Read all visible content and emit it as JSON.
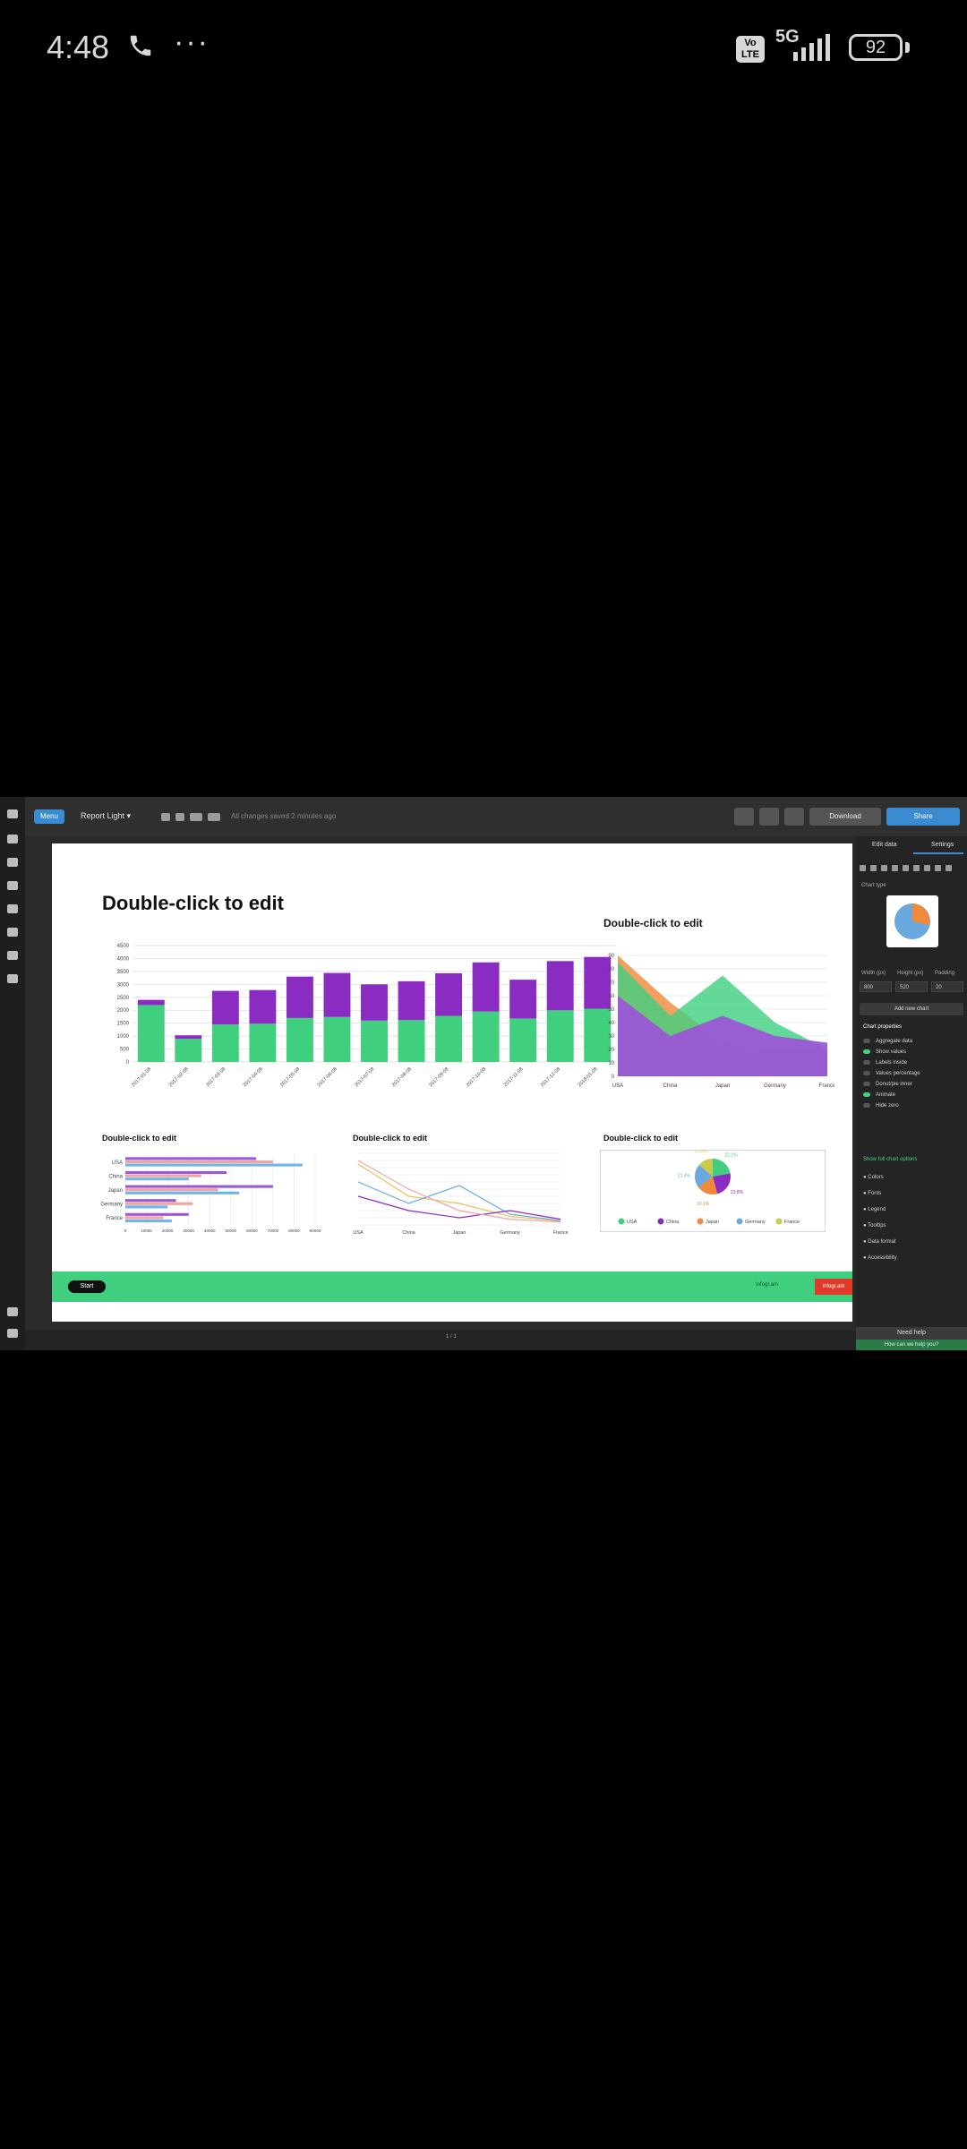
{
  "status_bar": {
    "time": "4:48",
    "call_icon": "phone-icon",
    "more": "···",
    "volte": "Vo LTE",
    "network": "5G",
    "battery": "92"
  },
  "app": {
    "menu_button": "Menu",
    "theme_select": "Report Light",
    "toolbar_hint": "All changes saved 2 minutes ago",
    "download_label": "Download",
    "share_label": "Share"
  },
  "canvas": {
    "main_title": "Double-click to edit",
    "area_title": "Double-click to edit",
    "hbar_title": "Double-click to edit",
    "line_title": "Double-click to edit",
    "pie_title": "Double-click to edit",
    "footer_pill": "Start",
    "footer_text": "Infogr.am",
    "footer_ribbon": "infogr.am",
    "caption": "1 / 1"
  },
  "sidebar": {
    "tab_edit": "Edit data",
    "tab_settings": "Settings",
    "chart_type_label": "Chart type",
    "width_label": "Width (px)",
    "height_label": "Height (px)",
    "padding_label": "Padding",
    "width_value": "800",
    "height_value": "520",
    "padding_value": "20",
    "convert_button": "Add new chart",
    "props_header": "Chart properties",
    "rows": [
      "Aggregate data",
      "Show values",
      "Labels inside",
      "Values percentage",
      "Donut/pie inner",
      "Animate",
      "Hide zero"
    ],
    "link": "Show full chart options",
    "sections": [
      "Colors",
      "Fonts",
      "Legend",
      "Tooltips",
      "Data format",
      "Accessibility"
    ],
    "help_button": "Need help",
    "bottom_text": "How can we help you?"
  },
  "chart_data": [
    {
      "type": "bar",
      "title": "Double-click to edit",
      "categories": [
        "2017-01-08",
        "2017-02-08",
        "2017-03-08",
        "2017-04-08",
        "2017-05-08",
        "2017-06-08",
        "2017-07-08",
        "2017-08-08",
        "2017-09-08",
        "2017-10-08",
        "2017-11-08",
        "2017-12-08",
        "2018-01-08"
      ],
      "series": [
        {
          "values": [
            2200,
            900,
            1450,
            1480,
            1700,
            1740,
            1600,
            1620,
            1780,
            1950,
            1680,
            2000,
            2060
          ]
        },
        {
          "values": [
            200,
            130,
            1300,
            1300,
            1600,
            1700,
            1400,
            1500,
            1650,
            1900,
            1500,
            1900,
            2000
          ]
        }
      ],
      "ylim": [
        0,
        4500
      ],
      "yticks": [
        "0",
        "500",
        "1000",
        "1500",
        "2000",
        "2500",
        "3000",
        "3500",
        "4000",
        "4500"
      ],
      "colors": [
        "#3fcf7f",
        "#8a2bc2"
      ]
    },
    {
      "type": "area",
      "title": "Double-click to edit",
      "categories": [
        "USA",
        "China",
        "Japan",
        "Germany",
        "France"
      ],
      "series": [
        {
          "values": [
            90,
            55,
            25,
            20,
            20
          ]
        },
        {
          "values": [
            85,
            45,
            75,
            40,
            20
          ]
        },
        {
          "values": [
            60,
            30,
            45,
            30,
            25
          ]
        }
      ],
      "ylim": [
        0,
        100
      ],
      "yticks": [
        "0",
        "10",
        "20",
        "30",
        "40",
        "50",
        "60",
        "70",
        "80",
        "90"
      ],
      "colors": [
        "#f08a3a",
        "#3fcf7f",
        "#9b59d6"
      ]
    },
    {
      "type": "bar",
      "orientation": "horizontal",
      "title": "Double-click to edit",
      "categories": [
        "USA",
        "China",
        "Japan",
        "Germany",
        "France"
      ],
      "series": [
        {
          "values": [
            62000,
            48000,
            70000,
            24000,
            30000
          ]
        },
        {
          "values": [
            70000,
            36000,
            44000,
            32000,
            18000
          ]
        },
        {
          "values": [
            84000,
            30000,
            54000,
            20000,
            22000
          ]
        }
      ],
      "xlim": [
        0,
        90000
      ],
      "xticks": [
        "0",
        "10000",
        "20000",
        "30000",
        "40000",
        "50000",
        "60000",
        "70000",
        "80000",
        "90000"
      ],
      "colors": [
        "#9b59d6",
        "#f0a6a0",
        "#6fb6e8"
      ]
    },
    {
      "type": "line",
      "title": "Double-click to edit",
      "categories": [
        "USA",
        "China",
        "Japan",
        "Germany",
        "France"
      ],
      "series": [
        {
          "values": [
            85,
            40,
            30,
            12,
            5
          ]
        },
        {
          "values": [
            60,
            30,
            55,
            15,
            6
          ]
        },
        {
          "values": [
            40,
            20,
            10,
            20,
            8
          ]
        },
        {
          "values": [
            90,
            50,
            20,
            8,
            4
          ]
        }
      ],
      "ylim": [
        0,
        100
      ],
      "colors": [
        "#e8c35a",
        "#6aa9e0",
        "#8a2bc2",
        "#f0a6a0"
      ]
    },
    {
      "type": "pie",
      "title": "Double-click to edit",
      "labels": [
        "USA",
        "China",
        "Japan",
        "Germany",
        "France"
      ],
      "values": [
        22.1,
        23.8,
        19.1,
        21.4,
        13.6
      ],
      "colors": [
        "#3fcf7f",
        "#8a2bc2",
        "#f08a3a",
        "#6aa9e0",
        "#c9c94a"
      ]
    }
  ]
}
